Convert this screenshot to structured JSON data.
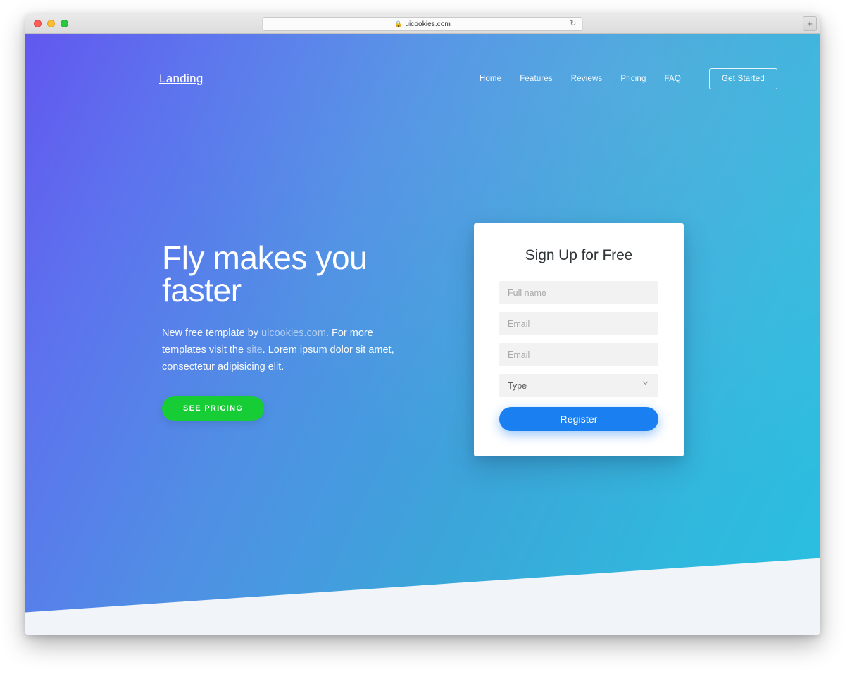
{
  "browser": {
    "url": "uicookies.com",
    "lock_icon": "lock-icon",
    "reload_icon": "reload-icon",
    "newtab_label": "+"
  },
  "nav": {
    "brand": "Landing",
    "links": [
      {
        "label": "Home"
      },
      {
        "label": "Features"
      },
      {
        "label": "Reviews"
      },
      {
        "label": "Pricing"
      },
      {
        "label": "FAQ"
      }
    ],
    "cta_label": "Get Started"
  },
  "hero": {
    "title": "Fly makes you faster",
    "sub_part1": "New free template by ",
    "sub_link1": "uicookies.com",
    "sub_part2": ". For more templates visit the ",
    "sub_link2": "site",
    "sub_part3": ". Lorem ipsum dolor sit amet, consectetur adipisicing elit.",
    "cta_label": "SEE PRICING"
  },
  "signup": {
    "title": "Sign Up for Free",
    "fields": [
      {
        "name": "full-name",
        "placeholder": "Full name",
        "value": ""
      },
      {
        "name": "email-1",
        "placeholder": "Email",
        "value": ""
      },
      {
        "name": "email-2",
        "placeholder": "Email",
        "value": ""
      }
    ],
    "select": {
      "selected": "Type",
      "chevron_icon": "chevron-down-icon"
    },
    "submit_label": "Register"
  },
  "colors": {
    "gradient_start": "#6258ef",
    "gradient_end": "#29c0e1",
    "green_cta": "#16cd35",
    "blue_cta": "#1a7ff0",
    "page_bottom": "#f1f4f9",
    "field_bg": "#f2f2f2"
  }
}
